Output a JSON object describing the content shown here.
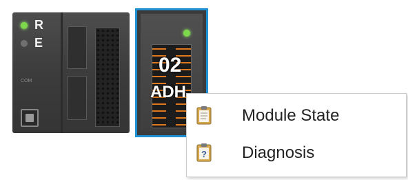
{
  "cpu_module": {
    "led_r_label": "R",
    "led_e_label": "E",
    "small_label": "COM"
  },
  "io_module": {
    "number": "02",
    "code": "ADH",
    "selected_border_color": "#1e90d6"
  },
  "context_menu": {
    "items": [
      {
        "label": "Module State",
        "icon": "clipboard-icon"
      },
      {
        "label": "Diagnosis",
        "icon": "clipboard-question-icon"
      }
    ]
  }
}
